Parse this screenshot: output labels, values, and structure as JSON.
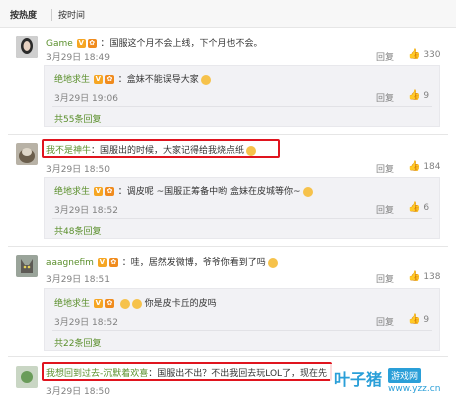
{
  "sort": {
    "hot": "按热度",
    "time": "按时间"
  },
  "actions": {
    "reply": "回复",
    "report": "回复"
  },
  "comments": [
    {
      "user": "Game",
      "text": "：国服这个月不会上线，下个月也不会。",
      "time": "3月29日 18:49",
      "likes": "330",
      "reply": {
        "user": "绝地求生",
        "text": "：盒妹不能误导大家",
        "time": "3月29日 19:06",
        "likes": "9"
      },
      "more": "共55条回复"
    },
    {
      "user": "我不是神牛",
      "text": "：国服出的时候，大家记得给我烧点纸",
      "time": "3月29日 18:50",
      "likes": "184",
      "reply": {
        "user": "绝地求生",
        "text": "：调皮呢 ~国服正筹备中哟 盒妹在皮城等你~",
        "time": "3月29日 18:52",
        "likes": "6"
      },
      "more": "共48条回复"
    },
    {
      "user": "aaagnefim",
      "text": "：哇，居然发微博，爷爷你看到了吗",
      "time": "3月29日 18:51",
      "likes": "138",
      "reply": {
        "user": "绝地求生",
        "text": "你是皮卡丘的皮吗",
        "time": "3月29日 18:52",
        "likes": "9"
      },
      "more": "共22条回复"
    },
    {
      "user": "我想回到过去-沉默着欢喜",
      "text": "：国服出不出？不出我回去玩LOL了，现在先",
      "time": "3月29日 18:50",
      "likes": ""
    }
  ],
  "watermark": {
    "brand": "叶子猪",
    "sub": "游戏网",
    "url": "www.yzz.cn"
  },
  "colors": {
    "highlight": "#e0141e",
    "username": "#eb7350",
    "replyUser": "#5a8f2b"
  }
}
